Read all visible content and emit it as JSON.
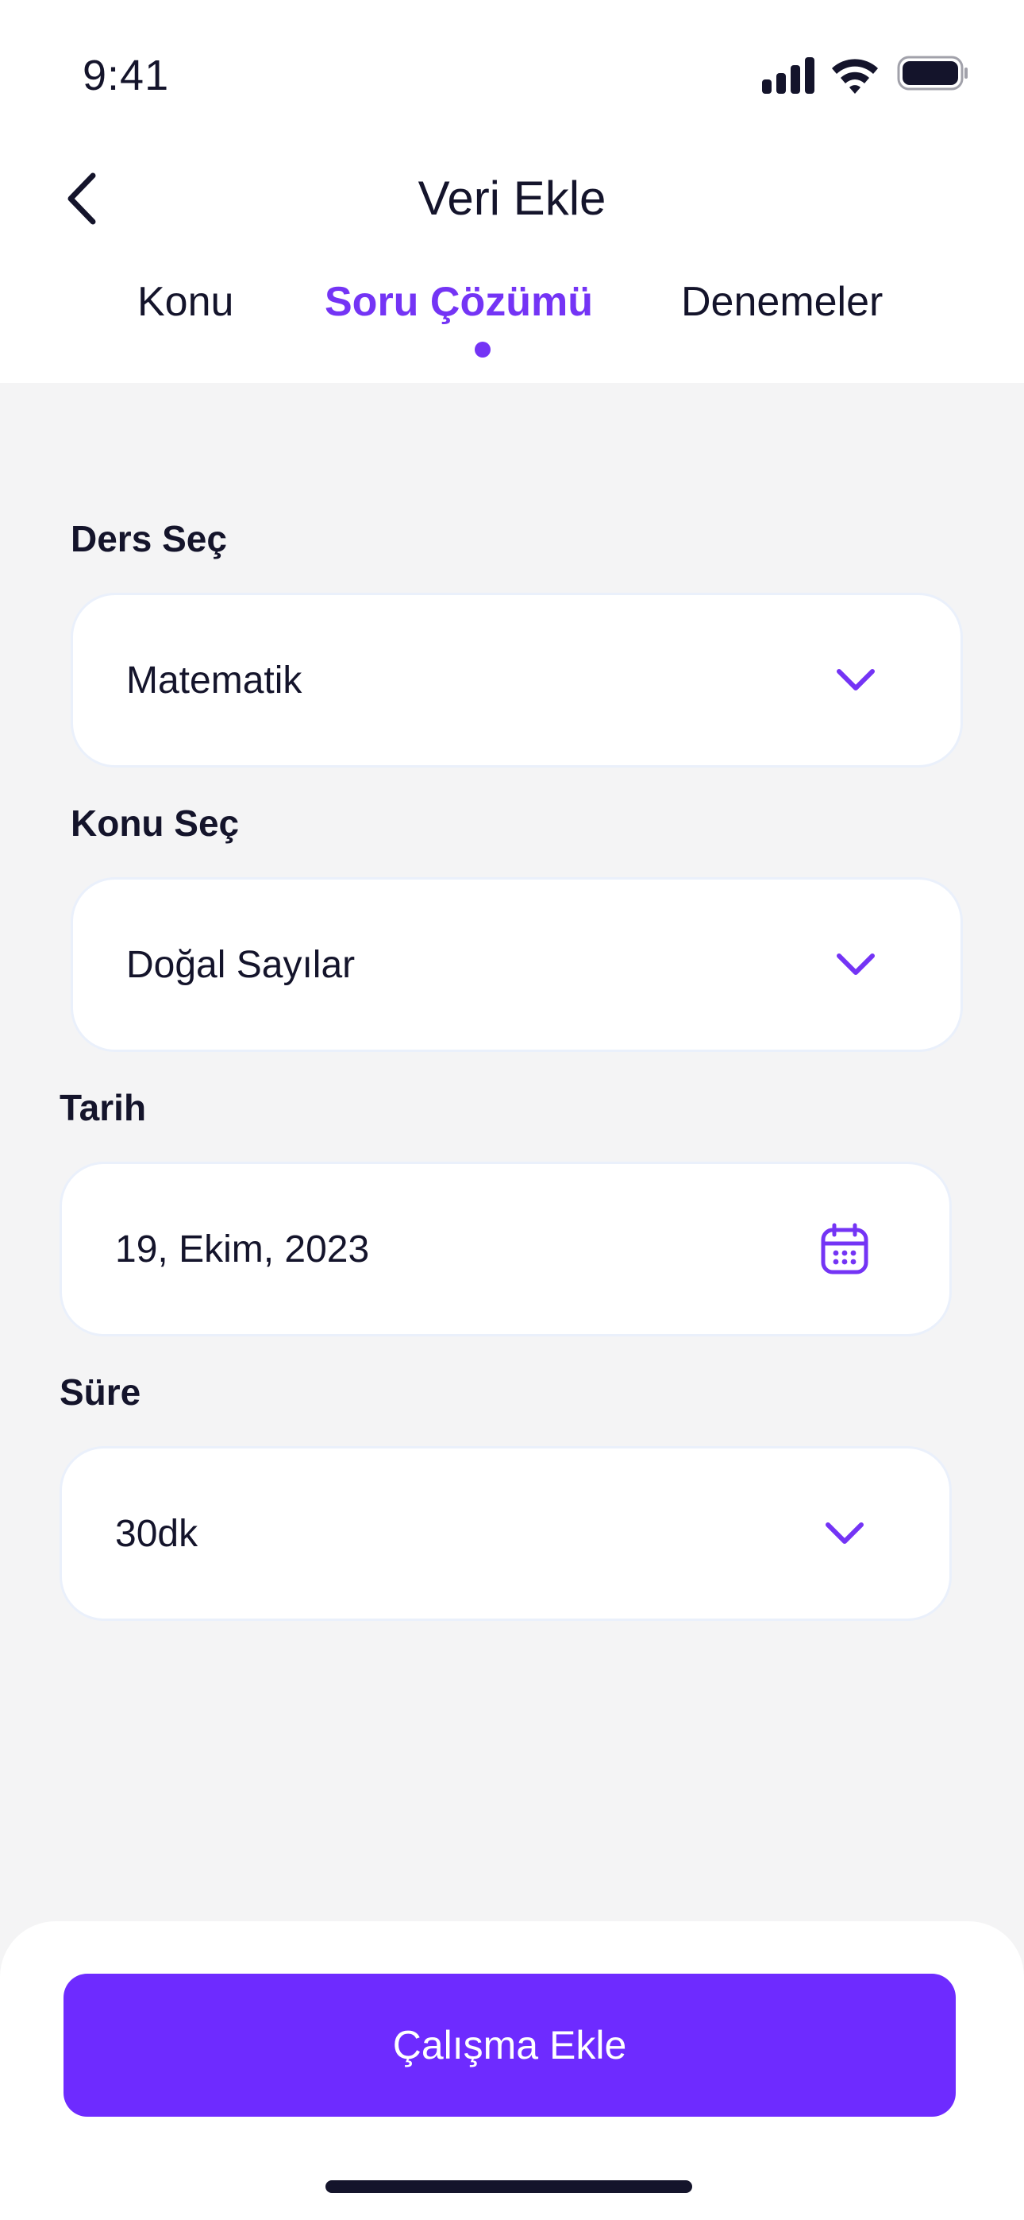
{
  "status_bar": {
    "time": "9:41",
    "icons": [
      "signal-icon",
      "wifi-icon",
      "battery-icon"
    ]
  },
  "header": {
    "title": "Veri Ekle",
    "back_icon": "chevron-left-icon"
  },
  "tabs": [
    {
      "label": "Konu",
      "active": false
    },
    {
      "label": "Soru Çözümü",
      "active": true
    },
    {
      "label": "Denemeler",
      "active": false
    }
  ],
  "form": {
    "subject": {
      "label": "Ders Seç",
      "value": "Matematik",
      "icon": "chevron-down-icon"
    },
    "topic": {
      "label": "Konu Seç",
      "value": "Doğal Sayılar",
      "icon": "chevron-down-icon"
    },
    "date": {
      "label": "Tarih",
      "value": "19, Ekim, 2023",
      "icon": "calendar-icon"
    },
    "duration": {
      "label": "Süre",
      "value": "30dk",
      "icon": "chevron-down-icon"
    }
  },
  "footer": {
    "submit_label": "Çalışma Ekle"
  },
  "colors": {
    "accent": "#7434f5",
    "button": "#6e2bff",
    "text": "#14142b",
    "background": "#f4f4f5"
  }
}
